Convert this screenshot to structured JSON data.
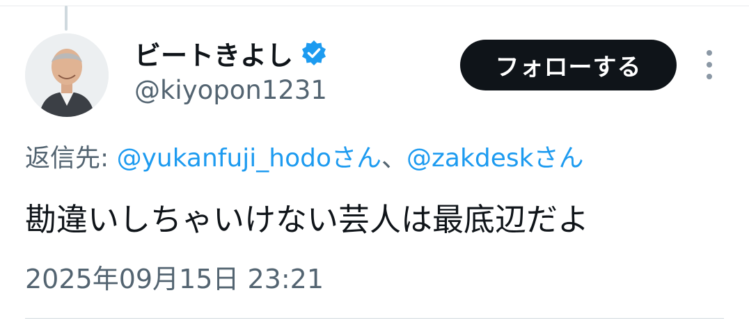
{
  "tweet": {
    "display_name": "ビートきよし",
    "handle": "@kiyopon1231",
    "verified_icon": "verified-badge-icon",
    "follow_label": "フォローする",
    "more_icon": "more-vertical-icon",
    "reply_prefix": "返信先: ",
    "mentions": [
      {
        "text": "@yukanfuji_hodoさん"
      },
      {
        "text": "@zakdeskさん"
      }
    ],
    "mention_separator": "、",
    "text": "勘違いしちゃいけない芸人は最底辺だよ",
    "timestamp": "2025年09月15日 23:21"
  },
  "colors": {
    "accent": "#1d9bf0",
    "text": "#0f1419",
    "secondary": "#536471",
    "follow_bg": "#0f1419"
  }
}
